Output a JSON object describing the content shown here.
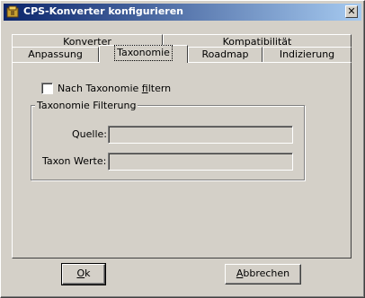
{
  "window": {
    "title": "CPS-Konverter konfigurieren",
    "close_symbol": "✕"
  },
  "tabs": {
    "row_back": [
      {
        "label": "Konverter"
      },
      {
        "label": "Kompatibilität"
      }
    ],
    "row_front": [
      {
        "label": "Anpassung",
        "selected": false
      },
      {
        "label": "Taxonomie",
        "selected": true
      },
      {
        "label": "Roadmap",
        "selected": false
      },
      {
        "label": "Indizierung",
        "selected": false
      }
    ]
  },
  "taxonomy": {
    "filter_checkbox": {
      "label_before": "Nach Taxonomie ",
      "label_mnemonic": "f",
      "label_after": "iltern",
      "checked": false
    },
    "group": {
      "title": "Taxonomie Filterung",
      "source": {
        "label": "Quelle:",
        "value": ""
      },
      "taxon_values": {
        "label": "Taxon Werte:",
        "value": ""
      }
    }
  },
  "buttons": {
    "ok": {
      "mnemonic": "O",
      "rest": "k"
    },
    "cancel": {
      "mnemonic": "A",
      "rest": "bbrechen"
    }
  }
}
